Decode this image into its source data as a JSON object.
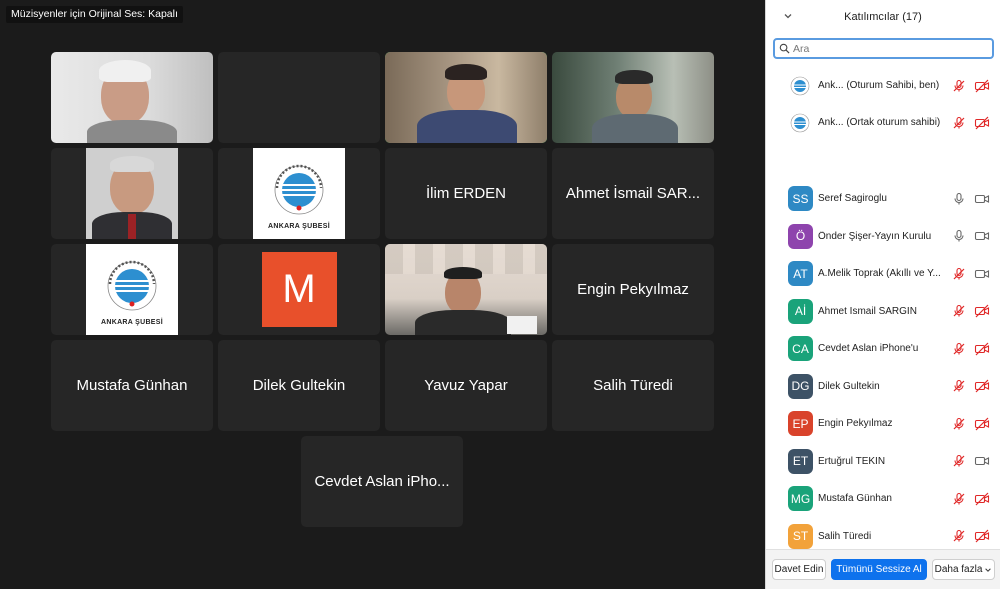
{
  "audio_banner": "Müzisyenler için Orijinal Ses: Kapalı",
  "tiles": {
    "ilim": "İlim ERDEN",
    "ahmet": "Ahmet İsmail SAR...",
    "engin": "Engin Pekyılmaz",
    "mustafa": "Mustafa Günhan",
    "dilek": "Dilek Gultekin",
    "yavuz": "Yavuz Yapar",
    "salih": "Salih Türedi",
    "cevdet": "Cevdet Aslan iPho...",
    "m_letter": "M",
    "logo_caption": "ANKARA ŞUBESİ"
  },
  "panel": {
    "title": "Katılımcılar (17)",
    "search_placeholder": "Ara",
    "hosts": [
      {
        "name": "Ank...  (Oturum Sahibi, ben)"
      },
      {
        "name": "Ank...  (Ortak oturum sahibi)"
      }
    ],
    "participants": [
      {
        "initials": "SS",
        "name": "Seref Sagiroglu",
        "color": "#2e89c4",
        "mic": "on",
        "cam": "on"
      },
      {
        "initials": "Ö",
        "name": "Önder Şişer-Yayın Kurulu",
        "color": "#8e44ad",
        "mic": "on",
        "cam": "on"
      },
      {
        "initials": "AT",
        "name": "A.Melik Toprak (Akıllı ve Y...",
        "color": "#2e89c4",
        "mic": "muted",
        "cam": "on"
      },
      {
        "initials": "Aİ",
        "name": "Ahmet İsmail SARGIN",
        "color": "#1aa37a",
        "mic": "muted",
        "cam": "off"
      },
      {
        "initials": "CA",
        "name": "Cevdet Aslan iPhone'u",
        "color": "#1aa37a",
        "mic": "muted",
        "cam": "off"
      },
      {
        "initials": "DG",
        "name": "Dilek Gultekin",
        "color": "#3d5266",
        "mic": "muted",
        "cam": "off"
      },
      {
        "initials": "EP",
        "name": "Engin Pekyılmaz",
        "color": "#d9432b",
        "mic": "muted",
        "cam": "off"
      },
      {
        "initials": "ET",
        "name": "Ertuğrul TEKİN",
        "color": "#3d5266",
        "mic": "muted",
        "cam": "on"
      },
      {
        "initials": "MG",
        "name": "Mustafa Günhan",
        "color": "#1aa37a",
        "mic": "muted",
        "cam": "off"
      },
      {
        "initials": "ST",
        "name": "Salih Türedi",
        "color": "#f2a23a",
        "mic": "muted",
        "cam": "off"
      }
    ],
    "footer": {
      "invite": "Davet Edin",
      "mute_all": "Tümünü Sessize Al",
      "more": "Daha fazla"
    }
  },
  "colors": {
    "active_speaker": "#2fd36a",
    "primary_button": "#0e72ed",
    "muted_red": "#e02828"
  }
}
